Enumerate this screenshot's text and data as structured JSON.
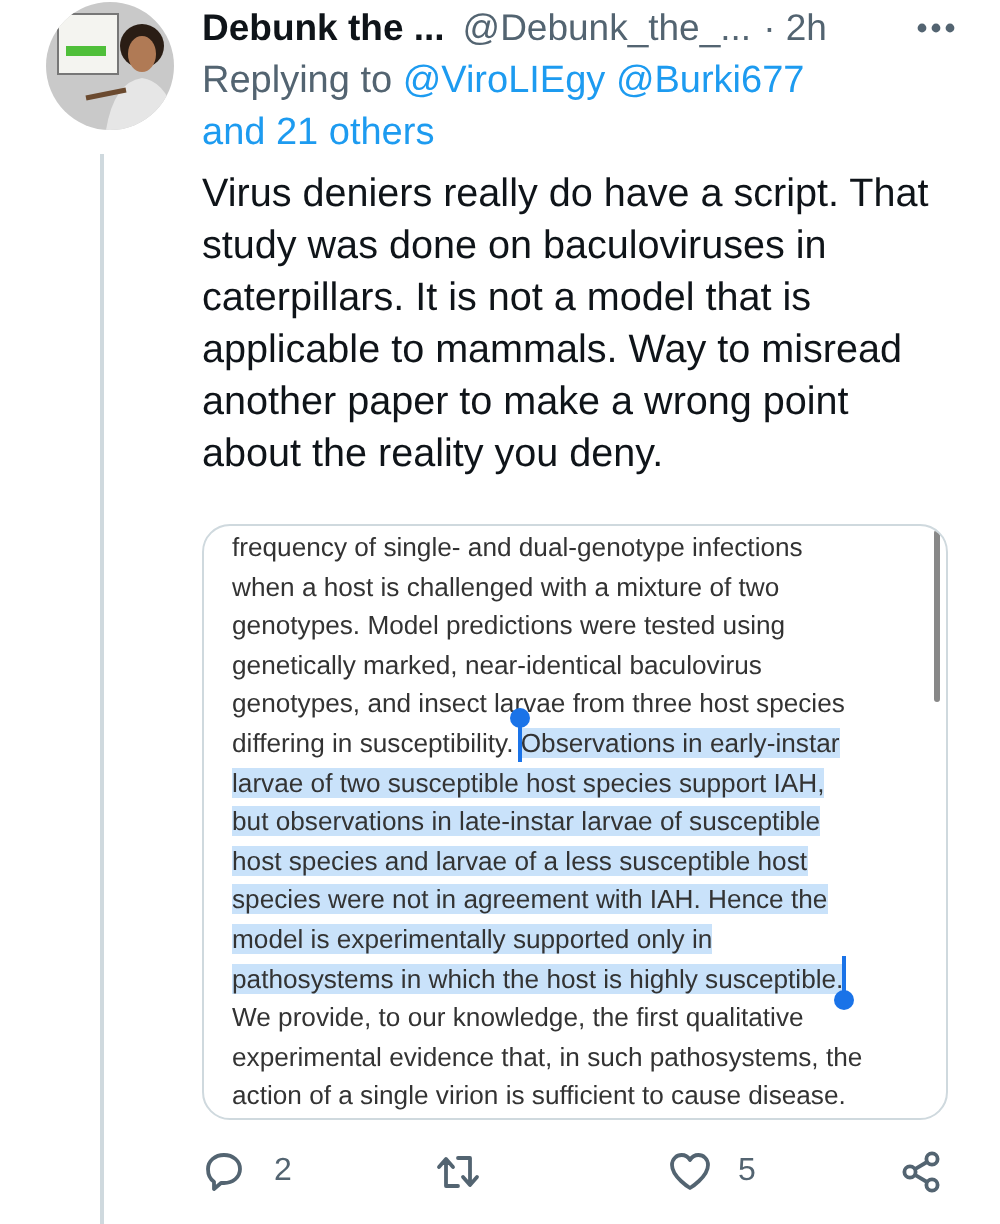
{
  "tweet": {
    "author": {
      "name": "Debunk the ...",
      "handle": "@Debunk_the_...",
      "time": "· 2h"
    },
    "replying": {
      "label": "Replying to",
      "mentions": [
        "@ViroLIEgy",
        "@Burki677",
        "and 21 others"
      ]
    },
    "text": "Virus deniers really do have a script. That study was done on baculoviruses in caterpillars. It is not a model that is applicable to mammals. Way to misread another paper to make a wrong point about the reality you deny.",
    "attachment": {
      "kind": "screenshot",
      "lines": [
        [
          {
            "text": "frequency of single- and dual-genotype infections",
            "selected": false
          }
        ],
        [
          {
            "text": "when a host is challenged with a mixture of two",
            "selected": false
          }
        ],
        [
          {
            "text": "genotypes. Model predictions were tested using",
            "selected": false
          }
        ],
        [
          {
            "text": "genetically marked, near-identical baculovirus",
            "selected": false
          }
        ],
        [
          {
            "text": "genotypes, and insect larvae from three host species",
            "selected": false
          }
        ],
        [
          {
            "text": "differing in susceptibility.",
            "selected": false
          },
          {
            "text": "Observations in early-instar",
            "selected": true
          }
        ],
        [
          {
            "text": "larvae of two susceptible host species support IAH,",
            "selected": true
          }
        ],
        [
          {
            "text": "but observations in late-instar larvae of susceptible",
            "selected": true
          }
        ],
        [
          {
            "text": "host species and larvae of a less susceptible host",
            "selected": true
          }
        ],
        [
          {
            "text": "species were not in agreement with IAH. Hence the",
            "selected": true
          }
        ],
        [
          {
            "text": "model is experimentally supported only in",
            "selected": true
          }
        ],
        [
          {
            "text": "pathosystems in which the host is highly susceptible.",
            "selected": true
          }
        ],
        [
          {
            "text": "We provide, to our knowledge, the first qualitative",
            "selected": false
          }
        ],
        [
          {
            "text": "experimental evidence that, in such pathosystems, the",
            "selected": false
          }
        ],
        [
          {
            "text": "action of a single virion is sufficient to cause disease.",
            "selected": false
          }
        ]
      ]
    },
    "actions": [
      {
        "kind": "reply",
        "count": "2"
      },
      {
        "kind": "retweet"
      },
      {
        "kind": "like",
        "count": "5"
      },
      {
        "kind": "share"
      }
    ]
  }
}
